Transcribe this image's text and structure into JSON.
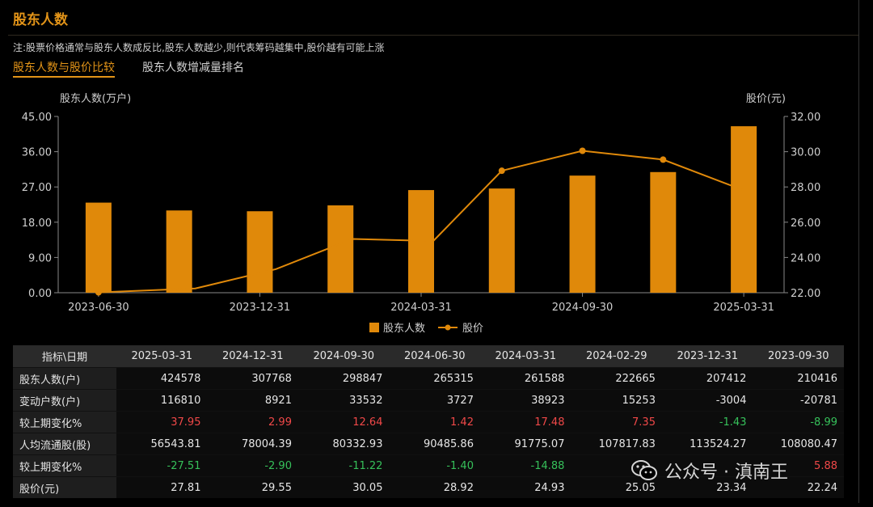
{
  "header": {
    "title": "股东人数",
    "note": "注:股票价格通常与股东人数成反比,股东人数越少,则代表筹码越集中,股价越有可能上涨",
    "tabs": [
      "股东人数与股价比较",
      "股东人数增减量排名"
    ]
  },
  "chart_data": {
    "type": "bar",
    "left_axis_label": "股东人数(万户)",
    "right_axis_label": "股价(元)",
    "y_left_ticks": [
      "0.00",
      "9.00",
      "18.00",
      "27.00",
      "36.00",
      "45.00"
    ],
    "y_left_range": [
      0,
      45
    ],
    "y_right_ticks": [
      "22.00",
      "24.00",
      "26.00",
      "28.00",
      "30.00",
      "32.00"
    ],
    "y_right_range": [
      22,
      32
    ],
    "x_tick_labels": [
      "2023-06-30",
      "2023-12-31",
      "2024-03-31",
      "2024-09-30",
      "2025-03-31"
    ],
    "x_tick_slots": [
      0,
      2,
      4,
      6,
      8
    ],
    "slot_count": 9,
    "series": [
      {
        "name": "股东人数",
        "kind": "bar",
        "axis": "left",
        "color": "#e0890a",
        "slots": [
          0,
          1,
          2,
          3,
          4,
          5,
          6,
          7,
          8
        ],
        "values": [
          23.0,
          21.0,
          20.8,
          22.3,
          26.2,
          26.6,
          29.9,
          30.8,
          42.5
        ]
      },
      {
        "name": "股价",
        "kind": "line",
        "axis": "right",
        "color": "#e0890a",
        "x": [
          0,
          1.2,
          2.2,
          3.15,
          4.15,
          5.0,
          6.0,
          7.0,
          8.0
        ],
        "values": [
          22.02,
          22.24,
          23.34,
          25.05,
          24.93,
          28.92,
          30.05,
          29.55,
          27.81
        ]
      }
    ],
    "legend_position": "bottom-center",
    "grid": false
  },
  "table": {
    "headers": [
      "指标\\日期",
      "2025-03-31",
      "2024-12-31",
      "2024-09-30",
      "2024-06-30",
      "2024-03-31",
      "2024-02-29",
      "2023-12-31",
      "2023-09-30"
    ],
    "rows": [
      {
        "label": "股东人数(户)",
        "cells": [
          "424578",
          "307768",
          "298847",
          "265315",
          "261588",
          "222665",
          "207412",
          "210416"
        ]
      },
      {
        "label": "变动户数(户)",
        "cells": [
          "116810",
          "8921",
          "33532",
          "3727",
          "38923",
          "15253",
          "-3004",
          "-20781"
        ]
      },
      {
        "label": "较上期变化%",
        "cells": [
          "37.95",
          "2.99",
          "12.64",
          "1.42",
          "17.48",
          "7.35",
          "-1.43",
          "-8.99"
        ]
      },
      {
        "label": "人均流通股(股)",
        "cells": [
          "56543.81",
          "78004.39",
          "80332.93",
          "90485.86",
          "91775.07",
          "107817.83",
          "113524.27",
          "108080.47"
        ]
      },
      {
        "label": "较上期变化%",
        "cells": [
          "-27.51",
          "-2.90",
          "-11.22",
          "-1.40",
          "-14.88",
          "",
          "",
          "5.88"
        ]
      },
      {
        "label": "股价(元)",
        "cells": [
          "27.81",
          "29.55",
          "30.05",
          "28.92",
          "24.93",
          "25.05",
          "23.34",
          "22.24"
        ]
      }
    ],
    "colors": {
      "positive": "#f04848",
      "negative": "#36c05a"
    }
  },
  "watermark": {
    "text": "公众号 · 滇南王",
    "icon": "wechat-icon"
  }
}
